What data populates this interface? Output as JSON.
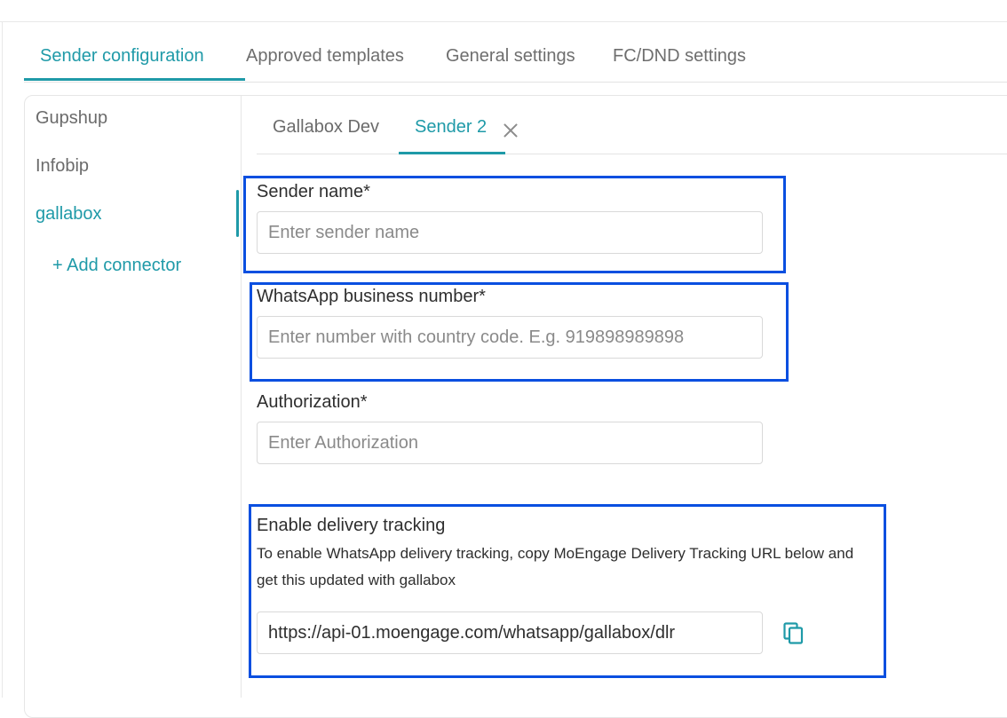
{
  "main_tabs": [
    {
      "label": "Sender configuration",
      "active": true
    },
    {
      "label": "Approved templates",
      "active": false
    },
    {
      "label": "General settings",
      "active": false
    },
    {
      "label": "FC/DND settings",
      "active": false
    }
  ],
  "sidebar": {
    "items": [
      {
        "label": "Gupshup",
        "active": false
      },
      {
        "label": "Infobip",
        "active": false
      },
      {
        "label": "gallabox",
        "active": true
      }
    ],
    "add_connector": "+ Add connector"
  },
  "sender_tabs": [
    {
      "label": "Gallabox Dev",
      "active": false
    },
    {
      "label": "Sender 2",
      "active": true,
      "closable": true
    }
  ],
  "form": {
    "sender_name": {
      "label": "Sender name*",
      "placeholder": "Enter sender name",
      "value": ""
    },
    "whatsapp_number": {
      "label": "WhatsApp business number*",
      "placeholder": "Enter number with country code. E.g. 919898989898",
      "value": ""
    },
    "authorization": {
      "label": "Authorization*",
      "placeholder": "Enter Authorization",
      "value": ""
    },
    "delivery_tracking": {
      "title": "Enable delivery tracking",
      "description": "To enable WhatsApp delivery tracking, copy MoEngage Delivery Tracking URL below and get this updated with gallabox",
      "url": "https://api-01.moengage.com/whatsapp/gallabox/dlr",
      "copy_icon": "copy-icon"
    }
  },
  "colors": {
    "accent": "#1f9aa8",
    "highlight_box": "#0a4fe0"
  }
}
